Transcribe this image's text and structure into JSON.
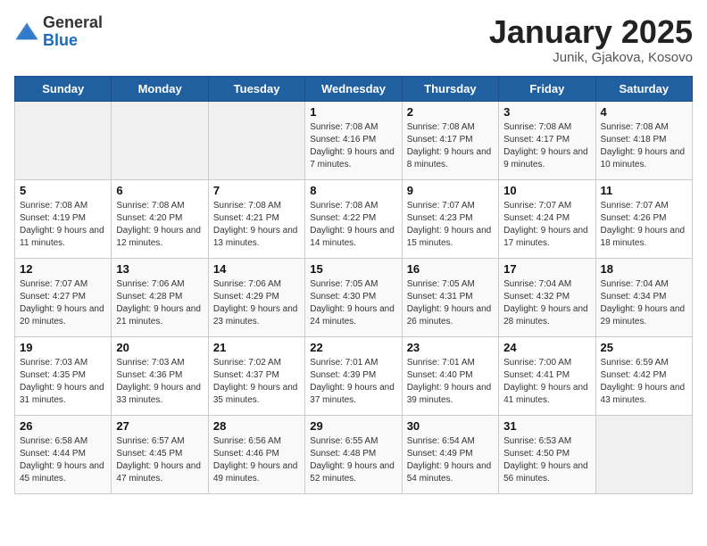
{
  "header": {
    "logo_general": "General",
    "logo_blue": "Blue",
    "title": "January 2025",
    "subtitle": "Junik, Gjakova, Kosovo"
  },
  "days_of_week": [
    "Sunday",
    "Monday",
    "Tuesday",
    "Wednesday",
    "Thursday",
    "Friday",
    "Saturday"
  ],
  "weeks": [
    [
      {
        "num": "",
        "info": ""
      },
      {
        "num": "",
        "info": ""
      },
      {
        "num": "",
        "info": ""
      },
      {
        "num": "1",
        "info": "Sunrise: 7:08 AM\nSunset: 4:16 PM\nDaylight: 9 hours and 7 minutes."
      },
      {
        "num": "2",
        "info": "Sunrise: 7:08 AM\nSunset: 4:17 PM\nDaylight: 9 hours and 8 minutes."
      },
      {
        "num": "3",
        "info": "Sunrise: 7:08 AM\nSunset: 4:17 PM\nDaylight: 9 hours and 9 minutes."
      },
      {
        "num": "4",
        "info": "Sunrise: 7:08 AM\nSunset: 4:18 PM\nDaylight: 9 hours and 10 minutes."
      }
    ],
    [
      {
        "num": "5",
        "info": "Sunrise: 7:08 AM\nSunset: 4:19 PM\nDaylight: 9 hours and 11 minutes."
      },
      {
        "num": "6",
        "info": "Sunrise: 7:08 AM\nSunset: 4:20 PM\nDaylight: 9 hours and 12 minutes."
      },
      {
        "num": "7",
        "info": "Sunrise: 7:08 AM\nSunset: 4:21 PM\nDaylight: 9 hours and 13 minutes."
      },
      {
        "num": "8",
        "info": "Sunrise: 7:08 AM\nSunset: 4:22 PM\nDaylight: 9 hours and 14 minutes."
      },
      {
        "num": "9",
        "info": "Sunrise: 7:07 AM\nSunset: 4:23 PM\nDaylight: 9 hours and 15 minutes."
      },
      {
        "num": "10",
        "info": "Sunrise: 7:07 AM\nSunset: 4:24 PM\nDaylight: 9 hours and 17 minutes."
      },
      {
        "num": "11",
        "info": "Sunrise: 7:07 AM\nSunset: 4:26 PM\nDaylight: 9 hours and 18 minutes."
      }
    ],
    [
      {
        "num": "12",
        "info": "Sunrise: 7:07 AM\nSunset: 4:27 PM\nDaylight: 9 hours and 20 minutes."
      },
      {
        "num": "13",
        "info": "Sunrise: 7:06 AM\nSunset: 4:28 PM\nDaylight: 9 hours and 21 minutes."
      },
      {
        "num": "14",
        "info": "Sunrise: 7:06 AM\nSunset: 4:29 PM\nDaylight: 9 hours and 23 minutes."
      },
      {
        "num": "15",
        "info": "Sunrise: 7:05 AM\nSunset: 4:30 PM\nDaylight: 9 hours and 24 minutes."
      },
      {
        "num": "16",
        "info": "Sunrise: 7:05 AM\nSunset: 4:31 PM\nDaylight: 9 hours and 26 minutes."
      },
      {
        "num": "17",
        "info": "Sunrise: 7:04 AM\nSunset: 4:32 PM\nDaylight: 9 hours and 28 minutes."
      },
      {
        "num": "18",
        "info": "Sunrise: 7:04 AM\nSunset: 4:34 PM\nDaylight: 9 hours and 29 minutes."
      }
    ],
    [
      {
        "num": "19",
        "info": "Sunrise: 7:03 AM\nSunset: 4:35 PM\nDaylight: 9 hours and 31 minutes."
      },
      {
        "num": "20",
        "info": "Sunrise: 7:03 AM\nSunset: 4:36 PM\nDaylight: 9 hours and 33 minutes."
      },
      {
        "num": "21",
        "info": "Sunrise: 7:02 AM\nSunset: 4:37 PM\nDaylight: 9 hours and 35 minutes."
      },
      {
        "num": "22",
        "info": "Sunrise: 7:01 AM\nSunset: 4:39 PM\nDaylight: 9 hours and 37 minutes."
      },
      {
        "num": "23",
        "info": "Sunrise: 7:01 AM\nSunset: 4:40 PM\nDaylight: 9 hours and 39 minutes."
      },
      {
        "num": "24",
        "info": "Sunrise: 7:00 AM\nSunset: 4:41 PM\nDaylight: 9 hours and 41 minutes."
      },
      {
        "num": "25",
        "info": "Sunrise: 6:59 AM\nSunset: 4:42 PM\nDaylight: 9 hours and 43 minutes."
      }
    ],
    [
      {
        "num": "26",
        "info": "Sunrise: 6:58 AM\nSunset: 4:44 PM\nDaylight: 9 hours and 45 minutes."
      },
      {
        "num": "27",
        "info": "Sunrise: 6:57 AM\nSunset: 4:45 PM\nDaylight: 9 hours and 47 minutes."
      },
      {
        "num": "28",
        "info": "Sunrise: 6:56 AM\nSunset: 4:46 PM\nDaylight: 9 hours and 49 minutes."
      },
      {
        "num": "29",
        "info": "Sunrise: 6:55 AM\nSunset: 4:48 PM\nDaylight: 9 hours and 52 minutes."
      },
      {
        "num": "30",
        "info": "Sunrise: 6:54 AM\nSunset: 4:49 PM\nDaylight: 9 hours and 54 minutes."
      },
      {
        "num": "31",
        "info": "Sunrise: 6:53 AM\nSunset: 4:50 PM\nDaylight: 9 hours and 56 minutes."
      },
      {
        "num": "",
        "info": ""
      }
    ]
  ]
}
